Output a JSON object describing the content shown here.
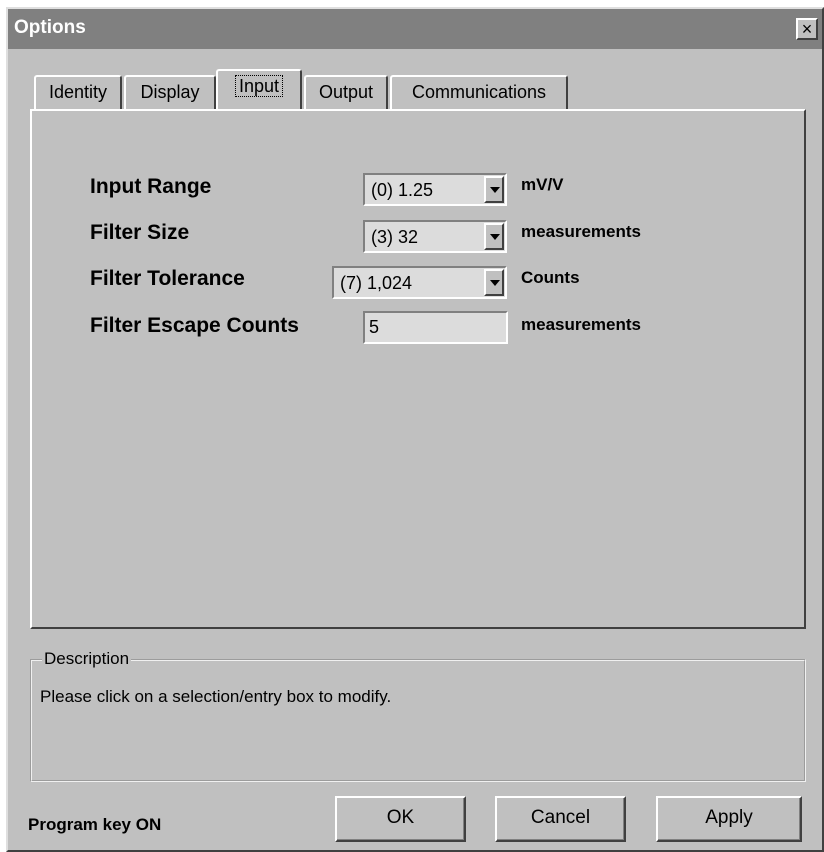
{
  "window": {
    "title": "Options",
    "close_glyph": "×"
  },
  "tabs": [
    {
      "label": "Identity",
      "active": false
    },
    {
      "label": "Display",
      "active": false
    },
    {
      "label": "Input",
      "active": true
    },
    {
      "label": "Output",
      "active": false
    },
    {
      "label": "Communications",
      "active": false
    }
  ],
  "fields": {
    "input_range": {
      "label": "Input Range",
      "value": "(0) 1.25",
      "unit": "mV/V"
    },
    "filter_size": {
      "label": "Filter Size",
      "value": "(3) 32",
      "unit": "measurements"
    },
    "filter_tolerance": {
      "label": "Filter Tolerance",
      "value": "(7) 1,024",
      "unit": "Counts"
    },
    "filter_escape_counts": {
      "label": "Filter Escape Counts",
      "value": "5",
      "unit": "measurements"
    }
  },
  "description": {
    "title": "Description",
    "text": "Please click on a selection/entry box to modify."
  },
  "status": "Program key ON",
  "buttons": {
    "ok": "OK",
    "cancel": "Cancel",
    "apply": "Apply"
  },
  "icons": {
    "close": "close-icon",
    "dropdown": "chevron-down-icon"
  }
}
